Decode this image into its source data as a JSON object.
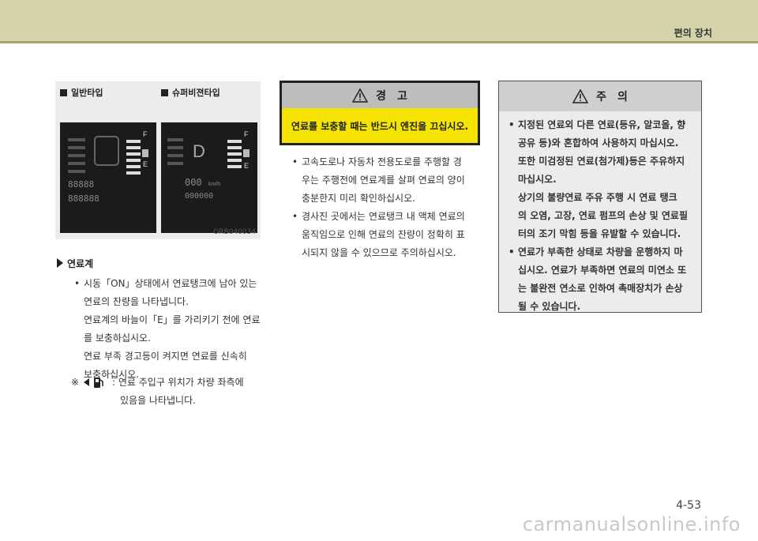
{
  "header": {
    "section": "편의 장치"
  },
  "figure": {
    "left_label": "일반타입",
    "right_label": "슈퍼비젼타입",
    "code": "ORB040034",
    "left_digits_top": "88888",
    "left_digits_bottom": "888888",
    "right_gear": "D",
    "right_speed": "000",
    "right_speed_unit": "km/h",
    "right_odo": "000000",
    "fuel_full": "F",
    "fuel_empty": "E"
  },
  "section": {
    "title": "연료계",
    "bullet": "•",
    "lines": [
      "시동「ON」상태에서 연료탱크에 남아 있는",
      "연료의 잔량을 나타냅니다.",
      "연료계의 바늘이「E」를 가리키기 전에 연료",
      "를 보충하십시오.",
      "연료 부족 경고등이 켜지면 연료를 신속히",
      "보충하십시오."
    ],
    "note_mark": "※",
    "note_lines": [
      ": 연료 주입구 위치가 차량 좌측에",
      "있음을 나타냅니다."
    ]
  },
  "warning": {
    "title": "경　고",
    "body": "연료를 보충할 때는 반드시 엔진을 끄십시오.",
    "bullets": [
      [
        "고속도로나 자동차 전용도로를 주행할 경",
        "우는 주행전에 연료계를 살펴 연료의 양이",
        "충분한지 미리 확인하십시오."
      ],
      [
        "경사진 곳에서는 연료탱크 내 액체 연료의",
        "움직임으로 인해 연료의 잔량이 정확히 표",
        "시되지 않을 수 있으므로 주의하십시오."
      ]
    ]
  },
  "caution": {
    "title": "주　의",
    "bullets": [
      [
        "지정된 연료외 다른 연료(등유, 알코올, 향",
        "공유 등)와 혼합하여 사용하지 마십시오.",
        "또한 미검정된 연료(첨가제)등은 주유하지",
        "마십시오.",
        "상기의 불량연료 주유 주행 시 연료 탱크",
        "의 오염, 고장, 연료 펌프의 손상 및 연료필",
        "터의 조기 막힘 등을 유발할 수 있습니다."
      ],
      [
        "연료가 부족한 상태로 차량을 운행하지 마",
        "십시오. 연료가 부족하면 연료의 미연소 또",
        "는 불완전 연소로 인하여 촉매장치가 손상",
        "될 수 있습니다."
      ]
    ]
  },
  "footer": {
    "page": "4-53",
    "watermark": "carmanualsonline.info"
  },
  "icons": [
    "warning-triangle-icon",
    "fuel-pump-icon",
    "arrow-left-icon",
    "square-bullet-icon"
  ]
}
